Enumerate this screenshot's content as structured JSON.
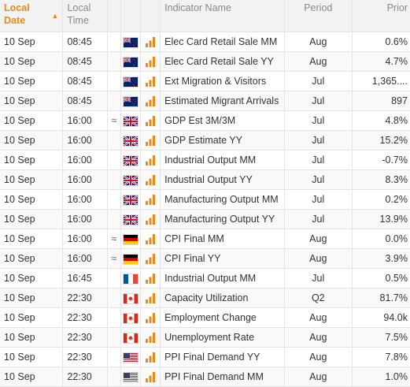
{
  "header": {
    "local_date": "Local\nDate",
    "local_time": "Local\nTime",
    "indicator_name": "Indicator Name",
    "period": "Period",
    "prior": "Prior"
  },
  "rows": [
    {
      "date": "10 Sep",
      "time": "08:45",
      "approx": "",
      "flag": "nz",
      "importance": "high",
      "name": "Elec Card Retail Sale MM",
      "period": "Aug",
      "prior": "0.6%"
    },
    {
      "date": "10 Sep",
      "time": "08:45",
      "approx": "",
      "flag": "nz",
      "importance": "high",
      "name": "Elec Card Retail Sale YY",
      "period": "Aug",
      "prior": "4.7%"
    },
    {
      "date": "10 Sep",
      "time": "08:45",
      "approx": "",
      "flag": "nz",
      "importance": "high",
      "name": "Ext Migration & Visitors",
      "period": "Jul",
      "prior": "1,365...."
    },
    {
      "date": "10 Sep",
      "time": "08:45",
      "approx": "",
      "flag": "nz",
      "importance": "high",
      "name": "Estimated Migrant Arrivals",
      "period": "Jul",
      "prior": "897"
    },
    {
      "date": "10 Sep",
      "time": "16:00",
      "approx": "≈",
      "flag": "uk",
      "importance": "high",
      "name": "GDP Est 3M/3M",
      "period": "Jul",
      "prior": "4.8%"
    },
    {
      "date": "10 Sep",
      "time": "16:00",
      "approx": "",
      "flag": "uk",
      "importance": "high",
      "name": "GDP Estimate YY",
      "period": "Jul",
      "prior": "15.2%"
    },
    {
      "date": "10 Sep",
      "time": "16:00",
      "approx": "",
      "flag": "uk",
      "importance": "high",
      "name": "Industrial Output MM",
      "period": "Jul",
      "prior": "-0.7%"
    },
    {
      "date": "10 Sep",
      "time": "16:00",
      "approx": "",
      "flag": "uk",
      "importance": "high",
      "name": "Industrial Output YY",
      "period": "Jul",
      "prior": "8.3%"
    },
    {
      "date": "10 Sep",
      "time": "16:00",
      "approx": "",
      "flag": "uk",
      "importance": "high",
      "name": "Manufacturing Output MM",
      "period": "Jul",
      "prior": "0.2%"
    },
    {
      "date": "10 Sep",
      "time": "16:00",
      "approx": "",
      "flag": "uk",
      "importance": "high",
      "name": "Manufacturing Output YY",
      "period": "Jul",
      "prior": "13.9%"
    },
    {
      "date": "10 Sep",
      "time": "16:00",
      "approx": "≈",
      "flag": "de",
      "importance": "high",
      "name": "CPI Final MM",
      "period": "Aug",
      "prior": "0.0%"
    },
    {
      "date": "10 Sep",
      "time": "16:00",
      "approx": "≈",
      "flag": "de",
      "importance": "high",
      "name": "CPI Final YY",
      "period": "Aug",
      "prior": "3.9%"
    },
    {
      "date": "10 Sep",
      "time": "16:45",
      "approx": "",
      "flag": "fr",
      "importance": "high",
      "name": "Industrial Output MM",
      "period": "Jul",
      "prior": "0.5%"
    },
    {
      "date": "10 Sep",
      "time": "22:30",
      "approx": "",
      "flag": "ca",
      "importance": "high",
      "name": "Capacity Utilization",
      "period": "Q2",
      "prior": "81.7%"
    },
    {
      "date": "10 Sep",
      "time": "22:30",
      "approx": "",
      "flag": "ca",
      "importance": "high",
      "name": "Employment Change",
      "period": "Aug",
      "prior": "94.0k"
    },
    {
      "date": "10 Sep",
      "time": "22:30",
      "approx": "",
      "flag": "ca",
      "importance": "high",
      "name": "Unemployment Rate",
      "period": "Aug",
      "prior": "7.5%"
    },
    {
      "date": "10 Sep",
      "time": "22:30",
      "approx": "",
      "flag": "us",
      "importance": "high",
      "name": "PPI Final Demand YY",
      "period": "Aug",
      "prior": "7.8%"
    },
    {
      "date": "10 Sep",
      "time": "22:30",
      "approx": "",
      "flag": "us",
      "importance": "high",
      "name": "PPI Final Demand MM",
      "period": "Aug",
      "prior": "1.0%"
    }
  ],
  "colors": {
    "accent": "#e8891a",
    "importance_inactive": "#d9d9d9"
  }
}
